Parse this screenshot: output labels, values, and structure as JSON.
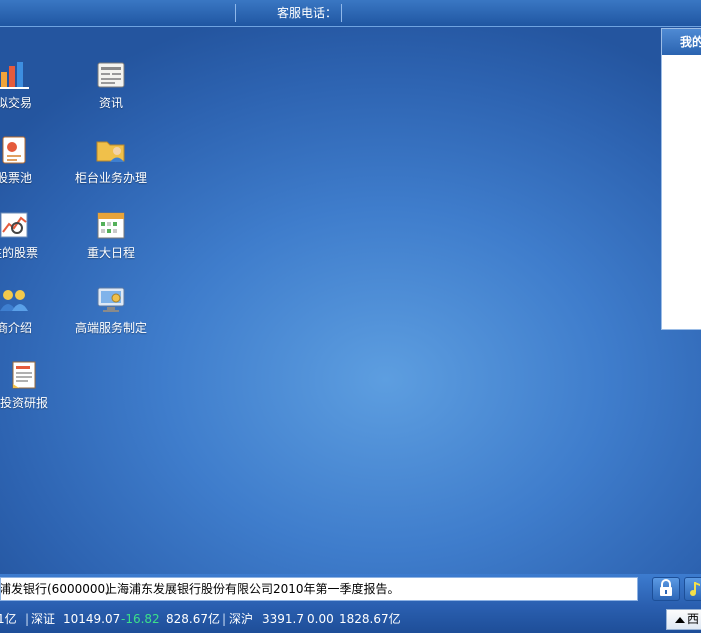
{
  "topbar": {
    "service_phone_label": "客服电话："
  },
  "right_panel": {
    "title": "我的"
  },
  "desktop_icons": [
    {
      "label": "拟交易",
      "icon": "bar-chart-icon"
    },
    {
      "label": "资讯",
      "icon": "news-document-icon"
    },
    {
      "label": "股票池",
      "icon": "stock-pool-icon"
    },
    {
      "label": "柜台业务办理",
      "icon": "folder-user-icon"
    },
    {
      "label": "注的股票",
      "icon": "watch-stock-icon"
    },
    {
      "label": "重大日程",
      "icon": "calendar-icon"
    },
    {
      "label": "商介绍",
      "icon": "users-icon"
    },
    {
      "label": "高端服务制定",
      "icon": "monitor-gear-icon"
    },
    {
      "label": "投资研报",
      "icon": "report-icon"
    }
  ],
  "ticker": {
    "stock": "浦发银行(6000000)",
    "message": "上海浦东发展银行股份有限公司2010年第一季度报告。"
  },
  "status": {
    "seg0": "1亿",
    "sz_label": "深证",
    "sz_index": "10149.07",
    "sz_change": "-16.82",
    "sz_volume": "828.67亿",
    "hs_label": "深沪",
    "hs_index": "3391.7",
    "hs_change": "0.00",
    "hs_volume": "1828.67亿",
    "expand_label": "西"
  }
}
